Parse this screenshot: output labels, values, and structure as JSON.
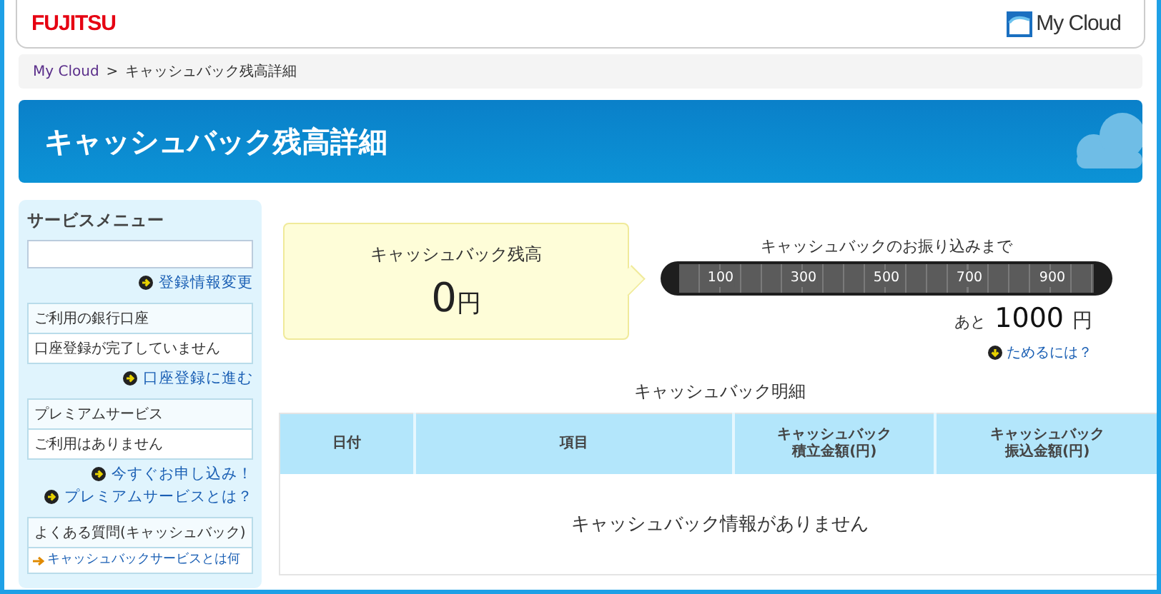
{
  "header": {
    "logo": "FUJITSU",
    "brand": "My Cloud"
  },
  "breadcrumb": [
    {
      "label": "My Cloud",
      "kind": "link"
    },
    {
      "label": ">",
      "kind": "separator"
    },
    {
      "label": "キャッシュバック残高詳細",
      "kind": "current"
    }
  ],
  "banner": {
    "title": "キャッシュバック残高詳細"
  },
  "sidebar": {
    "title": "サービスメニュー",
    "sections": [
      {
        "kind": "field",
        "links": [
          "登録情報変更"
        ]
      },
      {
        "kind": "box",
        "title": "ご利用の銀行口座",
        "text": "口座登録が完了していません",
        "links": [
          "口座登録に進む"
        ]
      },
      {
        "kind": "box",
        "title": "プレミアムサービス",
        "text": "ご利用はありません",
        "links": [
          "今すぐお申し込み！",
          "プレミアムサービスとは？"
        ]
      },
      {
        "kind": "faq",
        "title": "よくある質問(キャッシュバック)",
        "items": [
          "キャッシュバックサービスとは何"
        ]
      }
    ]
  },
  "balance": {
    "label": "キャッシュバック残高",
    "amount": "0",
    "unit": "円"
  },
  "gauge": {
    "title": "キャッシュバックのお振り込みまで",
    "ticks": [
      "100",
      "300",
      "500",
      "700",
      "900"
    ],
    "remaining_prefix": "あと",
    "remaining_amount": "1000",
    "remaining_unit": "円",
    "help_link": "ためるには？"
  },
  "details": {
    "title": "キャッシュバック明細",
    "columns": [
      {
        "label": "日付"
      },
      {
        "label": "項目"
      },
      {
        "lines": [
          "キャッシュバック",
          "積立金額(円)"
        ]
      },
      {
        "lines": [
          "キャッシュバック",
          "振込金額(円)"
        ]
      }
    ],
    "empty_message": "キャッシュバック情報がありません"
  }
}
